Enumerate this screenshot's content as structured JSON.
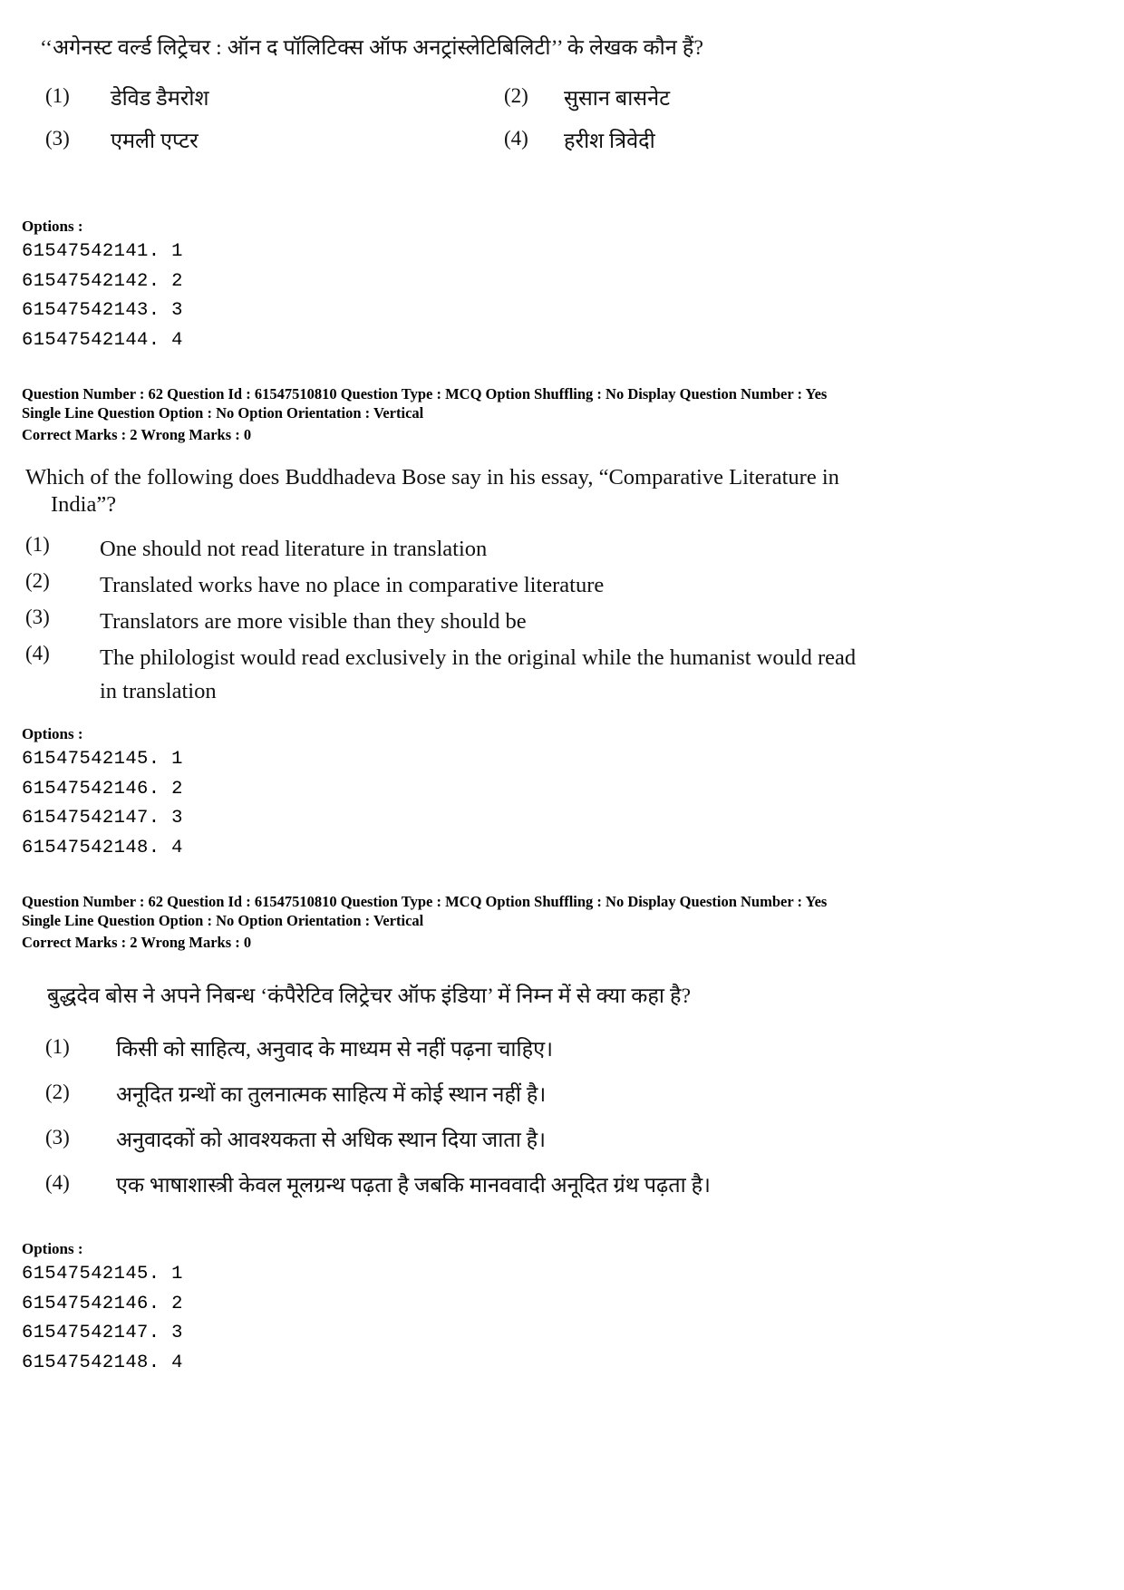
{
  "page": {
    "background": "#ffffff",
    "text_color": "#000000"
  },
  "block1": {
    "question_hi": "‘‘अगेनस्ट वर्ल्ड लिट्रेचर : ऑन द पॉलिटिक्स ऑफ अनट्रांस्लेटिबिलिटी’’ के लेखक कौन हैं?",
    "choices": [
      {
        "num": "(1)",
        "text": "डेविड डैमरोश"
      },
      {
        "num": "(2)",
        "text": "सुसान बासनेट"
      },
      {
        "num": "(3)",
        "text": "एमली एप्टर"
      },
      {
        "num": "(4)",
        "text": "हरीश त्रिवेदी"
      }
    ],
    "options_label": "Options :",
    "option_ids": [
      "61547542141. 1",
      "61547542142. 2",
      "61547542143. 3",
      "61547542144. 4"
    ]
  },
  "meta1": {
    "line1": "Question Number : 62  Question Id : 61547510810  Question Type : MCQ  Option Shuffling : No  Display Question Number : Yes",
    "line2": "Single Line Question Option : No  Option Orientation : Vertical",
    "line3": "Correct Marks : 2  Wrong Marks : 0"
  },
  "block2": {
    "question_en_line1": "Which of the following does Buddhadeva Bose say in his essay, “Comparative Literature in",
    "question_en_line2": "India”?",
    "choices": [
      {
        "num": "(1)",
        "text": "One should not read literature in translation"
      },
      {
        "num": "(2)",
        "text": "Translated works have no place in comparative literature"
      },
      {
        "num": "(3)",
        "text": "Translators are more visible than they should be"
      },
      {
        "num": "(4)",
        "line1": "The philologist would read exclusively in the original while the humanist would read",
        "line2": "in translation"
      }
    ],
    "options_label": "Options :",
    "option_ids": [
      "61547542145. 1",
      "61547542146. 2",
      "61547542147. 3",
      "61547542148. 4"
    ]
  },
  "meta2": {
    "line1": "Question Number : 62  Question Id : 61547510810  Question Type : MCQ  Option Shuffling : No  Display Question Number : Yes",
    "line2": "Single Line Question Option : No  Option Orientation : Vertical",
    "line3": "Correct Marks : 2  Wrong Marks : 0"
  },
  "block3": {
    "question_hi": "बुद्धदेव बोस ने अपने निबन्ध ‘कंपैरेटिव लिट्रेचर ऑफ इंडिया’ में निम्न में से क्या कहा है?",
    "choices": [
      {
        "num": "(1)",
        "text": "किसी को साहित्य, अनुवाद के माध्यम से नहीं पढ़ना चाहिए।"
      },
      {
        "num": "(2)",
        "text": "अनूदित ग्रन्थों का तुलनात्मक साहित्य में कोई स्थान नहीं है।"
      },
      {
        "num": "(3)",
        "text": "अनुवादकों को आवश्यकता से अधिक स्थान दिया जाता है।"
      },
      {
        "num": "(4)",
        "text": "एक भाषाशास्त्री केवल मूलग्रन्थ पढ़ता है जबकि मानववादी अनूदित ग्रंथ पढ़ता है।"
      }
    ],
    "options_label": "Options :",
    "option_ids": [
      "61547542145. 1",
      "61547542146. 2",
      "61547542147. 3",
      "61547542148. 4"
    ]
  }
}
